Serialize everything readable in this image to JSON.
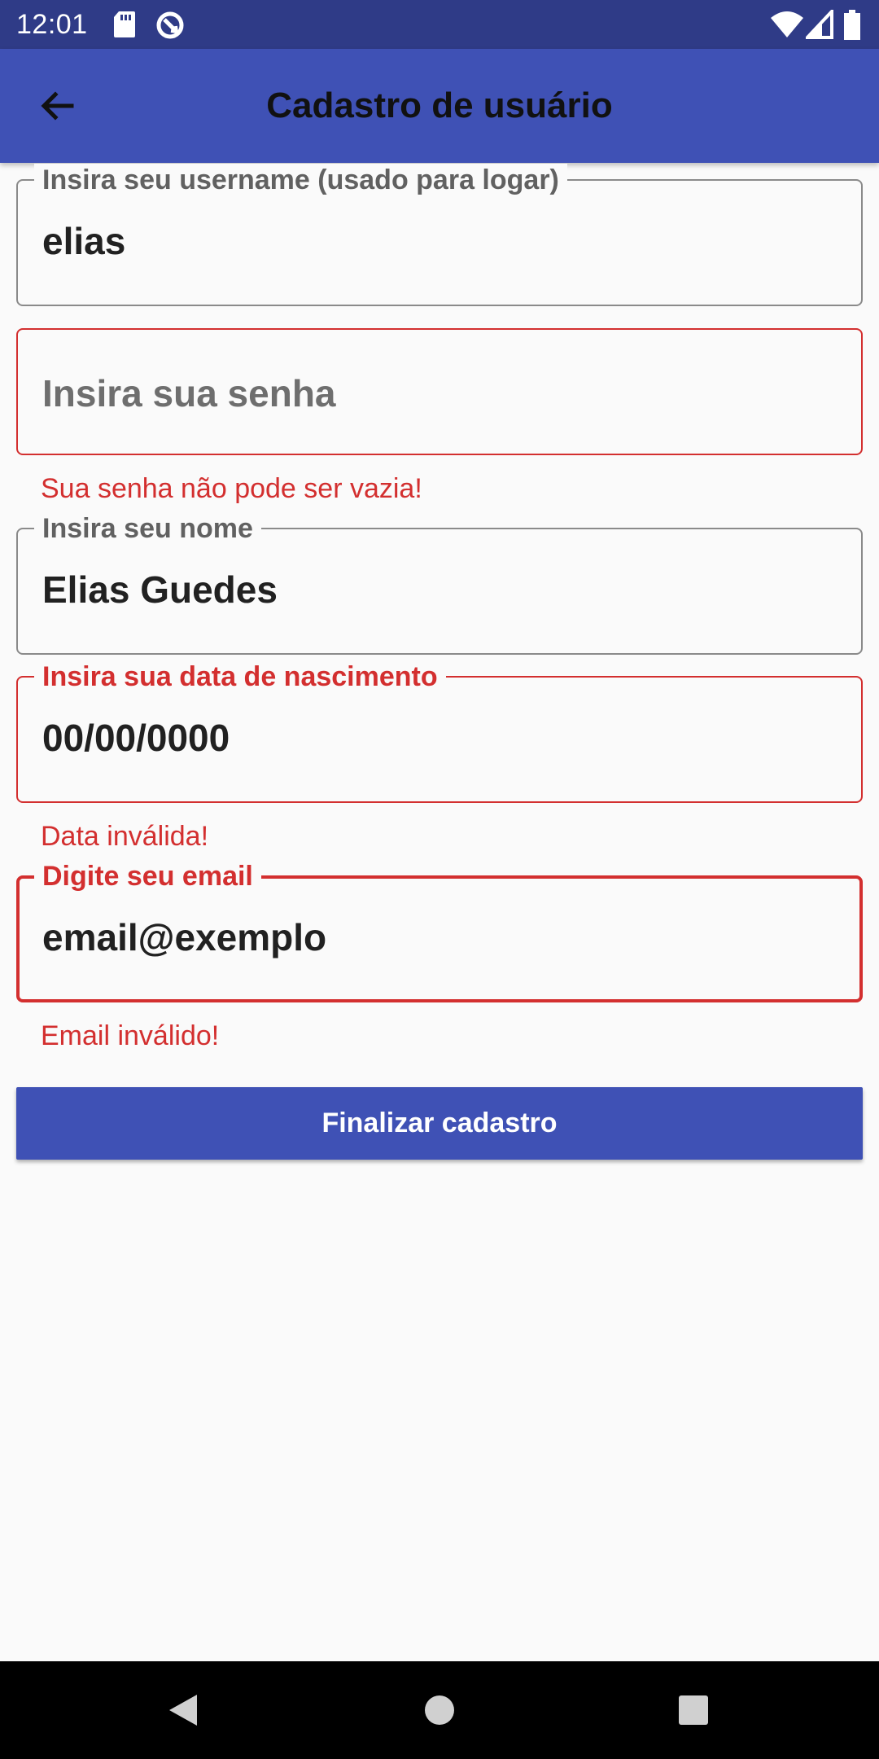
{
  "status_bar": {
    "time": "12:01",
    "left_icons": [
      "sd-card-icon",
      "sync-icon"
    ],
    "right_icons": [
      "wifi-icon",
      "cell-signal-icon",
      "battery-icon"
    ]
  },
  "app_bar": {
    "back_icon": "arrow-back-icon",
    "title": "Cadastro de usuário",
    "color": "#3f51b5"
  },
  "form": {
    "username": {
      "label": "Insira seu username (usado para logar)",
      "value": "elias"
    },
    "password": {
      "placeholder": "Insira sua senha",
      "value": "",
      "error": "Sua senha não pode ser vazia!"
    },
    "name": {
      "label": "Insira seu nome",
      "value": "Elias Guedes"
    },
    "birthdate": {
      "label": "Insira sua data de nascimento",
      "value": "00/00/0000",
      "error": "Data inválida!"
    },
    "email": {
      "label": "Digite seu email",
      "value": "email@exemplo",
      "error": "Email inválido!"
    },
    "submit_label": "Finalizar cadastro",
    "error_color": "#d32f2f"
  },
  "nav_bar": {
    "icons": [
      "back-triangle-icon",
      "home-circle-icon",
      "recents-square-icon"
    ]
  }
}
